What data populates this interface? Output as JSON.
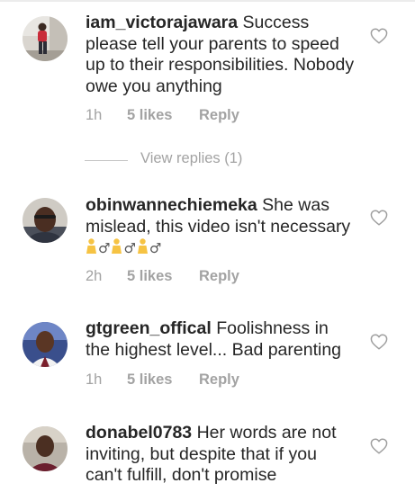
{
  "comments": [
    {
      "username": "iam_victorajawara",
      "text": "Success please tell your parents to speed up to their responsibilities. Nobody owe you anything",
      "time": "1h",
      "likes": "5 likes",
      "reply": "Reply",
      "view_replies": "View replies (1)"
    },
    {
      "username": "obinwannechiemeka",
      "text": "She was mislead,  this video isn't necessary",
      "emoji": "🙇‍♂️🙇‍♂️🙇‍♂️",
      "time": "2h",
      "likes": "5 likes",
      "reply": "Reply"
    },
    {
      "username": "gtgreen_offical",
      "text": "Foolishness in the highest level... Bad parenting",
      "time": "1h",
      "likes": "5 likes",
      "reply": "Reply"
    },
    {
      "username": "donabel0783",
      "text": "Her words are not inviting, but despite that if you can't fulfill, don't promise"
    }
  ],
  "icons": {
    "like": "heart-outline-icon",
    "avatar": "user-photo"
  },
  "colors": {
    "text": "#262626",
    "muted": "#a3a3a3",
    "emoji": "#f6c343"
  }
}
